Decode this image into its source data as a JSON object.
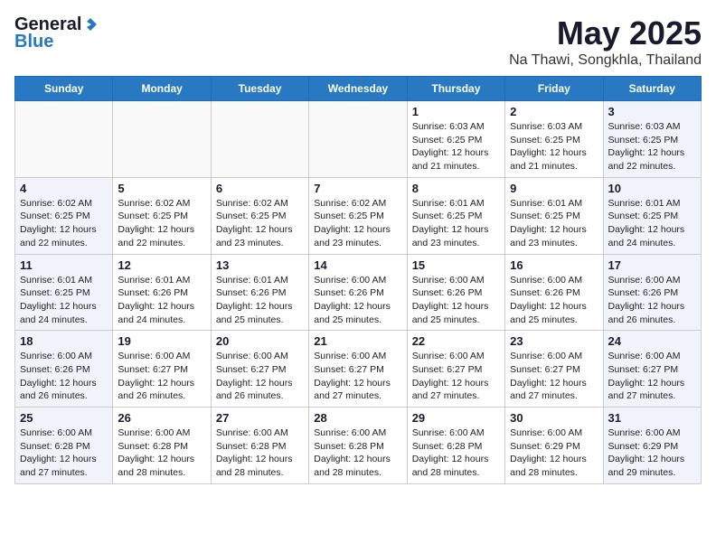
{
  "header": {
    "logo_general": "General",
    "logo_blue": "Blue",
    "title": "May 2025",
    "subtitle": "Na Thawi, Songkhla, Thailand"
  },
  "days_of_week": [
    "Sunday",
    "Monday",
    "Tuesday",
    "Wednesday",
    "Thursday",
    "Friday",
    "Saturday"
  ],
  "weeks": [
    [
      {
        "day": "",
        "info": ""
      },
      {
        "day": "",
        "info": ""
      },
      {
        "day": "",
        "info": ""
      },
      {
        "day": "",
        "info": ""
      },
      {
        "day": "1",
        "info": "Sunrise: 6:03 AM\nSunset: 6:25 PM\nDaylight: 12 hours\nand 21 minutes."
      },
      {
        "day": "2",
        "info": "Sunrise: 6:03 AM\nSunset: 6:25 PM\nDaylight: 12 hours\nand 21 minutes."
      },
      {
        "day": "3",
        "info": "Sunrise: 6:03 AM\nSunset: 6:25 PM\nDaylight: 12 hours\nand 22 minutes."
      }
    ],
    [
      {
        "day": "4",
        "info": "Sunrise: 6:02 AM\nSunset: 6:25 PM\nDaylight: 12 hours\nand 22 minutes."
      },
      {
        "day": "5",
        "info": "Sunrise: 6:02 AM\nSunset: 6:25 PM\nDaylight: 12 hours\nand 22 minutes."
      },
      {
        "day": "6",
        "info": "Sunrise: 6:02 AM\nSunset: 6:25 PM\nDaylight: 12 hours\nand 23 minutes."
      },
      {
        "day": "7",
        "info": "Sunrise: 6:02 AM\nSunset: 6:25 PM\nDaylight: 12 hours\nand 23 minutes."
      },
      {
        "day": "8",
        "info": "Sunrise: 6:01 AM\nSunset: 6:25 PM\nDaylight: 12 hours\nand 23 minutes."
      },
      {
        "day": "9",
        "info": "Sunrise: 6:01 AM\nSunset: 6:25 PM\nDaylight: 12 hours\nand 23 minutes."
      },
      {
        "day": "10",
        "info": "Sunrise: 6:01 AM\nSunset: 6:25 PM\nDaylight: 12 hours\nand 24 minutes."
      }
    ],
    [
      {
        "day": "11",
        "info": "Sunrise: 6:01 AM\nSunset: 6:25 PM\nDaylight: 12 hours\nand 24 minutes."
      },
      {
        "day": "12",
        "info": "Sunrise: 6:01 AM\nSunset: 6:26 PM\nDaylight: 12 hours\nand 24 minutes."
      },
      {
        "day": "13",
        "info": "Sunrise: 6:01 AM\nSunset: 6:26 PM\nDaylight: 12 hours\nand 25 minutes."
      },
      {
        "day": "14",
        "info": "Sunrise: 6:00 AM\nSunset: 6:26 PM\nDaylight: 12 hours\nand 25 minutes."
      },
      {
        "day": "15",
        "info": "Sunrise: 6:00 AM\nSunset: 6:26 PM\nDaylight: 12 hours\nand 25 minutes."
      },
      {
        "day": "16",
        "info": "Sunrise: 6:00 AM\nSunset: 6:26 PM\nDaylight: 12 hours\nand 25 minutes."
      },
      {
        "day": "17",
        "info": "Sunrise: 6:00 AM\nSunset: 6:26 PM\nDaylight: 12 hours\nand 26 minutes."
      }
    ],
    [
      {
        "day": "18",
        "info": "Sunrise: 6:00 AM\nSunset: 6:26 PM\nDaylight: 12 hours\nand 26 minutes."
      },
      {
        "day": "19",
        "info": "Sunrise: 6:00 AM\nSunset: 6:27 PM\nDaylight: 12 hours\nand 26 minutes."
      },
      {
        "day": "20",
        "info": "Sunrise: 6:00 AM\nSunset: 6:27 PM\nDaylight: 12 hours\nand 26 minutes."
      },
      {
        "day": "21",
        "info": "Sunrise: 6:00 AM\nSunset: 6:27 PM\nDaylight: 12 hours\nand 27 minutes."
      },
      {
        "day": "22",
        "info": "Sunrise: 6:00 AM\nSunset: 6:27 PM\nDaylight: 12 hours\nand 27 minutes."
      },
      {
        "day": "23",
        "info": "Sunrise: 6:00 AM\nSunset: 6:27 PM\nDaylight: 12 hours\nand 27 minutes."
      },
      {
        "day": "24",
        "info": "Sunrise: 6:00 AM\nSunset: 6:27 PM\nDaylight: 12 hours\nand 27 minutes."
      }
    ],
    [
      {
        "day": "25",
        "info": "Sunrise: 6:00 AM\nSunset: 6:28 PM\nDaylight: 12 hours\nand 27 minutes."
      },
      {
        "day": "26",
        "info": "Sunrise: 6:00 AM\nSunset: 6:28 PM\nDaylight: 12 hours\nand 28 minutes."
      },
      {
        "day": "27",
        "info": "Sunrise: 6:00 AM\nSunset: 6:28 PM\nDaylight: 12 hours\nand 28 minutes."
      },
      {
        "day": "28",
        "info": "Sunrise: 6:00 AM\nSunset: 6:28 PM\nDaylight: 12 hours\nand 28 minutes."
      },
      {
        "day": "29",
        "info": "Sunrise: 6:00 AM\nSunset: 6:28 PM\nDaylight: 12 hours\nand 28 minutes."
      },
      {
        "day": "30",
        "info": "Sunrise: 6:00 AM\nSunset: 6:29 PM\nDaylight: 12 hours\nand 28 minutes."
      },
      {
        "day": "31",
        "info": "Sunrise: 6:00 AM\nSunset: 6:29 PM\nDaylight: 12 hours\nand 29 minutes."
      }
    ]
  ]
}
